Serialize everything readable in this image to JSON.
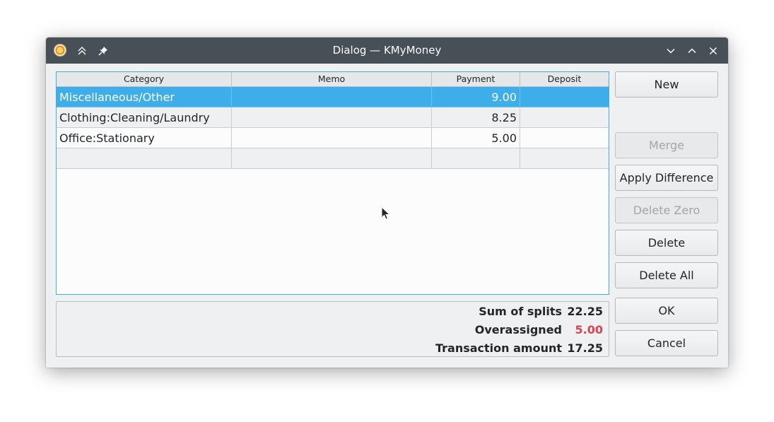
{
  "window": {
    "title": "Dialog — KMyMoney"
  },
  "table": {
    "columns": [
      "Category",
      "Memo",
      "Payment",
      "Deposit"
    ],
    "rows": [
      {
        "category": "Miscellaneous/Other",
        "memo": "",
        "payment": "9.00",
        "deposit": ""
      },
      {
        "category": "Clothing:Cleaning/Laundry",
        "memo": "",
        "payment": "8.25",
        "deposit": ""
      },
      {
        "category": "Office:Stationary",
        "memo": "",
        "payment": "5.00",
        "deposit": ""
      },
      {
        "category": "",
        "memo": "",
        "payment": "",
        "deposit": ""
      }
    ]
  },
  "summary": {
    "sum_label": "Sum of splits",
    "sum_value": "22.25",
    "over_label": "Overassigned",
    "over_value": "5.00",
    "txn_label": "Transaction amount",
    "txn_value": "17.25"
  },
  "buttons": {
    "new": "New",
    "merge": "Merge",
    "apply_difference": "Apply Difference",
    "delete_zero": "Delete Zero",
    "delete": "Delete",
    "delete_all": "Delete All",
    "ok": "OK",
    "cancel": "Cancel"
  },
  "colors": {
    "selection": "#3daee9",
    "overassigned": "#da4453",
    "titlebar": "#475057"
  },
  "icons": [
    "kmymoney-app-icon",
    "keep-above-icon",
    "pin-icon",
    "minimize-icon",
    "maximize-icon",
    "close-icon",
    "mouse-cursor-icon"
  ]
}
